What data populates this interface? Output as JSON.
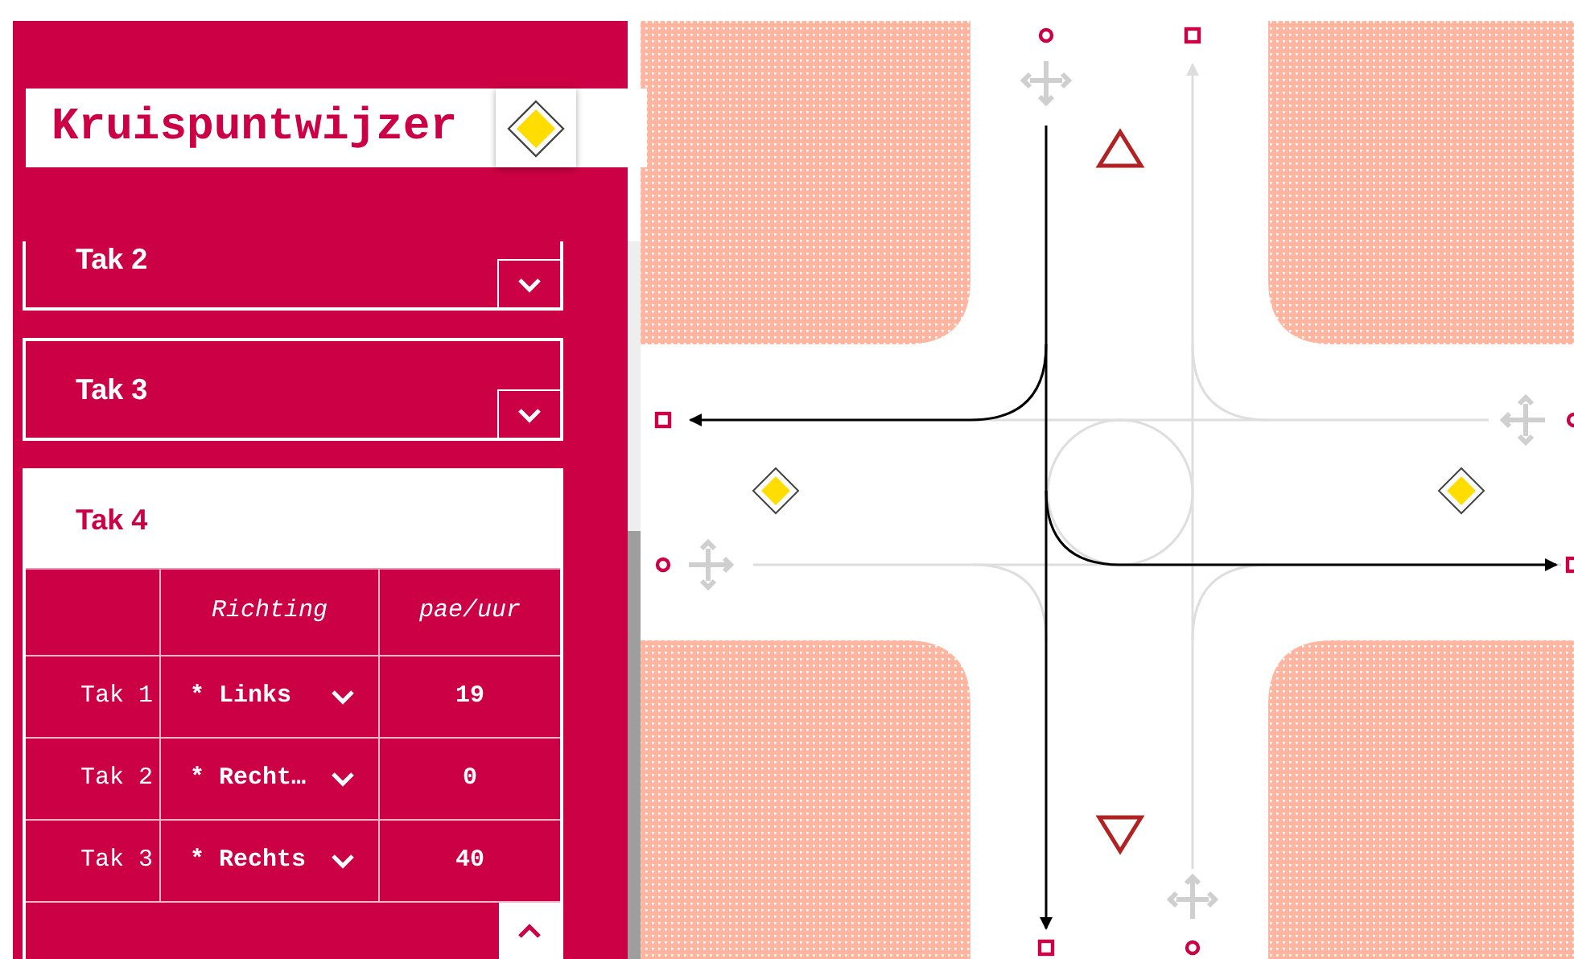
{
  "app": {
    "title": "Kruispuntwijzer"
  },
  "branches": [
    {
      "label": "Tak 2",
      "expanded": false
    },
    {
      "label": "Tak 3",
      "expanded": false
    },
    {
      "label": "Tak 4",
      "expanded": true,
      "table": {
        "columns": [
          "Richting",
          "pae/uur"
        ],
        "rows": [
          {
            "from": "Tak 1",
            "direction": "* Links",
            "volume": "19"
          },
          {
            "from": "Tak 2",
            "direction": "* Recht…",
            "volume": "0"
          },
          {
            "from": "Tak 3",
            "direction": "* Rechts",
            "volume": "40"
          }
        ]
      }
    }
  ]
}
